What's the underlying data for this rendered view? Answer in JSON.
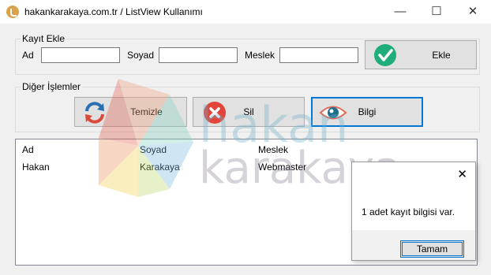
{
  "window": {
    "title": "hakankarakaya.com.tr / ListView Kullanımı",
    "minimize": "—",
    "maximize": "☐",
    "close": "✕"
  },
  "kayit_ekle": {
    "legend": "Kayıt Ekle",
    "ad_label": "Ad",
    "soyad_label": "Soyad",
    "meslek_label": "Meslek",
    "ad_value": "",
    "soyad_value": "",
    "meslek_value": "",
    "ekle_label": "Ekle",
    "ekle_icon": "checkmark-icon"
  },
  "diger": {
    "legend": "Diğer İşlemler",
    "temizle_label": "Temizle",
    "temizle_icon": "refresh-icon",
    "sil_label": "Sil",
    "sil_icon": "delete-icon",
    "bilgi_label": "Bilgi",
    "bilgi_icon": "eye-icon"
  },
  "listview": {
    "columns": [
      "Ad",
      "Soyad",
      "Meslek"
    ],
    "rows": [
      [
        "Hakan",
        "Karakaya",
        "Webmaster"
      ]
    ]
  },
  "watermark": {
    "line1": "hakan",
    "line2": "karakaya"
  },
  "dialog": {
    "message": "1 adet kayıt bilgisi var.",
    "ok_label": "Tamam",
    "close": "✕"
  },
  "colors": {
    "accent": "#0078d7",
    "check_green": "#1fae7a",
    "delete_red": "#e2463a",
    "eye_teal": "#1e6f8c"
  }
}
